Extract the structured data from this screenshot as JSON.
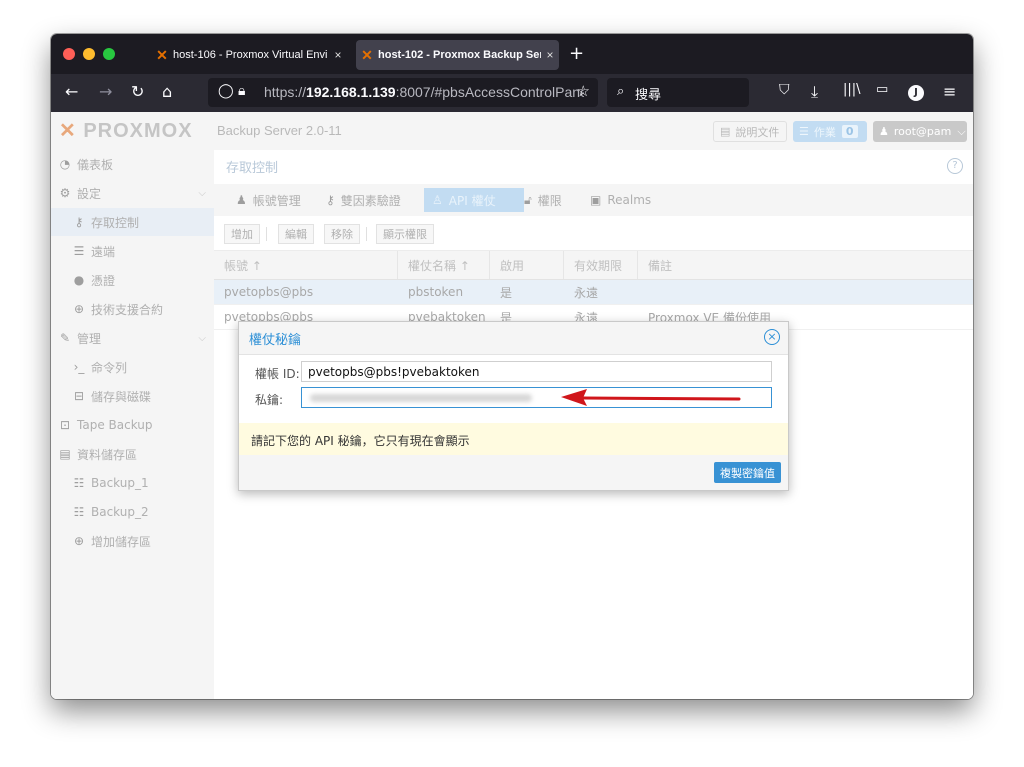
{
  "browser": {
    "tabs": [
      {
        "label": "host-106 - Proxmox Virtual Envi"
      },
      {
        "label": "host-102 - Proxmox Backup Ser"
      }
    ],
    "url_prefix": "https://",
    "url_host": "192.168.1.139",
    "url_rest": ":8007/#pbsAccessControlPanel",
    "search_placeholder": "搜尋"
  },
  "app": {
    "logo_text": "PROXMOX",
    "product": "Backup Server 2.0-11",
    "docs_label": "說明文件",
    "tasks_label": "作業",
    "tasks_count": "0",
    "user_label": "root@pam"
  },
  "sidebar": {
    "items": [
      {
        "label": "儀表板"
      },
      {
        "label": "設定"
      },
      {
        "label": "存取控制"
      },
      {
        "label": "遠端"
      },
      {
        "label": "憑證"
      },
      {
        "label": "技術支援合約"
      },
      {
        "label": "管理"
      },
      {
        "label": "命令列"
      },
      {
        "label": "儲存與磁碟"
      },
      {
        "label": "Tape Backup"
      },
      {
        "label": "資料儲存區"
      },
      {
        "label": "Backup_1"
      },
      {
        "label": "Backup_2"
      },
      {
        "label": "增加儲存區"
      }
    ]
  },
  "main": {
    "title": "存取控制",
    "tabs": [
      {
        "label": "帳號管理"
      },
      {
        "label": "雙因素驗證"
      },
      {
        "label": "API 權仗"
      },
      {
        "label": "權限"
      },
      {
        "label": "Realms"
      }
    ],
    "toolbar": {
      "add": "增加",
      "edit": "編輯",
      "remove": "移除",
      "show_perms": "顯示權限"
    },
    "columns": [
      "帳號 ↑",
      "權仗名稱 ↑",
      "啟用",
      "有效期限",
      "備註"
    ],
    "rows": [
      [
        "pvetopbs@pbs",
        "pbstoken",
        "是",
        "永遠",
        ""
      ],
      [
        "pvetopbs@pbs",
        "pvebaktoken",
        "是",
        "永遠",
        "Proxmox VE 備份使用"
      ]
    ]
  },
  "dialog": {
    "title": "權仗秘鑰",
    "token_id_label": "權帳 ID:",
    "token_id_value": "pvetopbs@pbs!pvebaktoken",
    "secret_label": "私鑰:",
    "notice": "請記下您的 API 秘鑰，它只有現在會顯示",
    "copy_button": "複製密鑰值"
  },
  "colors": {
    "accent": "#3892d4",
    "arrow": "#d0161b",
    "brand_orange": "#e57000"
  }
}
